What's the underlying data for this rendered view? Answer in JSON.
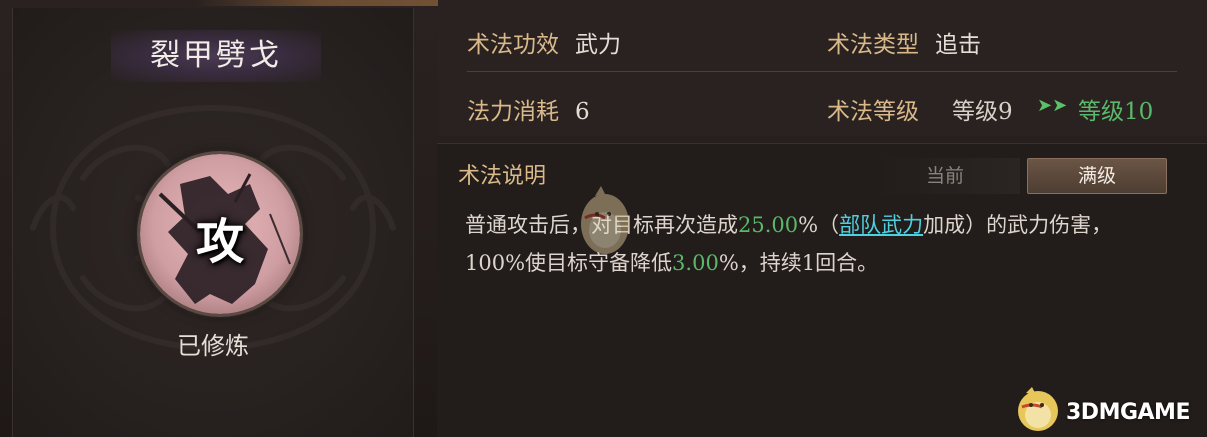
{
  "skill": {
    "name": "裂甲劈戈",
    "badge_char": "攻",
    "status": "已修炼"
  },
  "stats": {
    "effect_label": "术法功效",
    "effect_value": "武力",
    "type_label": "术法类型",
    "type_value": "追击",
    "cost_label": "法力消耗",
    "cost_value": "6",
    "level_label": "术法等级",
    "level_current": "等级9",
    "level_next": "等级10"
  },
  "description": {
    "title": "术法说明",
    "tab_current": "当前",
    "tab_max": "满级",
    "line1_a": "普通攻击后，对目标再次造成",
    "line1_pct": "25.00",
    "line1_b": "%（",
    "line1_link": "部队武力",
    "line1_c": "加成）的武力伤害，",
    "line2_a": "100%使目标守备降低",
    "line2_pct": "3.00",
    "line2_b": "%，持续1回合。"
  },
  "watermark": {
    "text": "3DMGAME"
  },
  "colors": {
    "label_gold": "#d9b98a",
    "highlight_green": "#5ab86a",
    "link_cyan": "#4fd0e0"
  }
}
